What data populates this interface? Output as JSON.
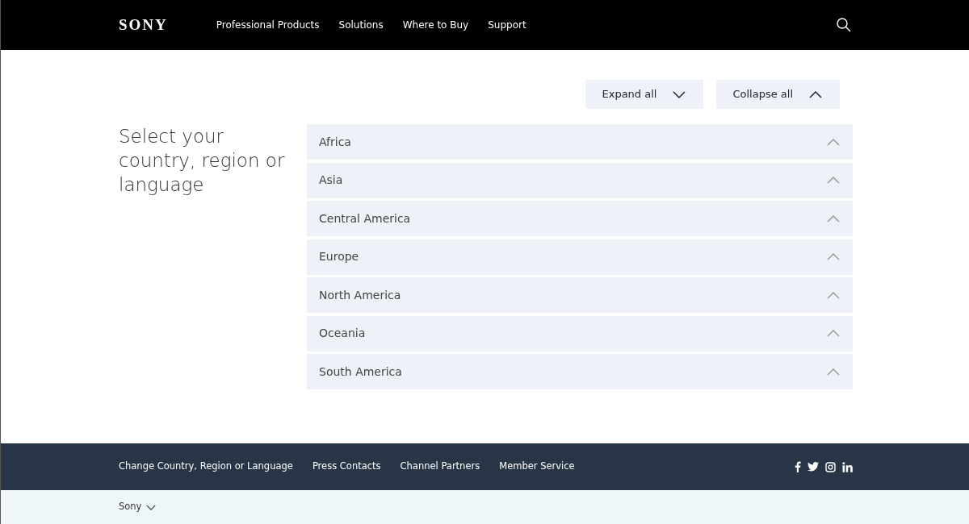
{
  "header": {
    "logo": "SONY",
    "nav": [
      "Professional Products",
      "Solutions",
      "Where to Buy",
      "Support"
    ]
  },
  "toolbar": {
    "buttons": [
      {
        "label": "Expand all",
        "kind": "expand"
      },
      {
        "label": "Collapse all",
        "kind": "collapse"
      }
    ]
  },
  "heading": "Select your country, region or language",
  "regions": [
    {
      "label": "Africa",
      "expanded": false
    },
    {
      "label": "Asia",
      "expanded": false
    },
    {
      "label": "Central America",
      "expanded": false
    },
    {
      "label": "Europe",
      "expanded": false
    },
    {
      "label": "North America",
      "expanded": false
    },
    {
      "label": "Oceania",
      "expanded": false
    },
    {
      "label": "South America",
      "expanded": false
    }
  ],
  "footer": {
    "links": [
      "Change Country, Region or Language",
      "Press Contacts",
      "Channel Partners",
      "Member Service"
    ]
  },
  "subfooter": {
    "label": "Sony"
  }
}
